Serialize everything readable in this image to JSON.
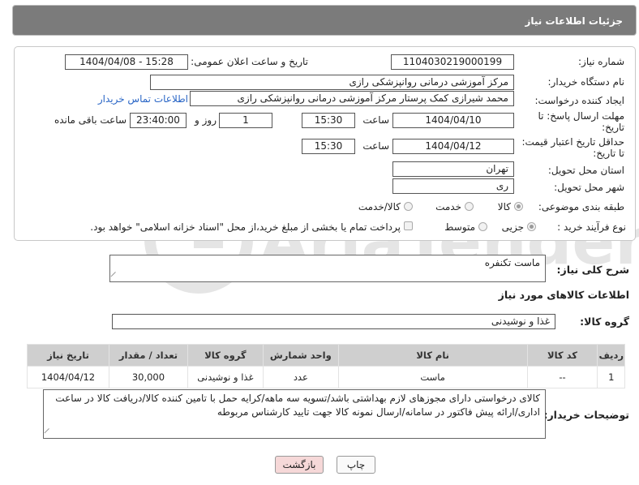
{
  "header": {
    "title": "جزئیات اطلاعات نیاز"
  },
  "labels": {
    "need_number": "شماره نیاز:",
    "announce_datetime": "تاریخ و ساعت اعلان عمومی:",
    "buyer_org": "نام دستگاه خریدار:",
    "requester": "ایجاد کننده درخواست:",
    "contact_link": "اطلاعات تماس خریدار",
    "reply_deadline_1": "مهلت ارسال پاسخ: تا",
    "reply_deadline_2": "تاریخ:",
    "time": "ساعت",
    "day_and": "روز و",
    "remaining": "ساعت باقی مانده",
    "price_validity_1": "حداقل تاریخ اعتبار قیمت:",
    "price_validity_2": "تا تاریخ:",
    "province": "استان محل تحویل:",
    "city": "شهر محل تحویل:",
    "category": "طبقه بندی موضوعی:",
    "process": "نوع فرآیند خرید :",
    "general_desc": "شرح کلی نیاز:",
    "items_info": "اطلاعات کالاهای مورد نیاز",
    "goods_group": "گروه کالا:",
    "buyer_notes": "توضیحات خریدار:"
  },
  "values": {
    "need_number": "1104030219000199",
    "announce_datetime": "1404/04/08 - 15:28",
    "buyer_org": "مرکز آموزشی درمانی روانپزشکی رازی",
    "requester": "محمد شیرازی کمک پرستار مرکز آموزشی درمانی روانپزشکی رازی",
    "reply_date": "1404/04/10",
    "reply_time": "15:30",
    "reply_days": "1",
    "reply_remaining": "23:40:00",
    "price_date": "1404/04/12",
    "price_time": "15:30",
    "province": "تهران",
    "city": "ری",
    "general_desc": "ماست تکنفره",
    "goods_group": "غذا و نوشیدنی",
    "buyer_notes": "کالای درخواستی دارای مجوزهای لازم بهداشتی باشد/تسویه سه ماهه/کرایه حمل با تامین کننده کالا/دریافت کالا در ساعت اداری/ارائه پیش فاکتور در سامانه/ارسال نمونه کالا جهت تایید کارشناس مربوطه"
  },
  "category_options": [
    {
      "label": "کالا",
      "selected": true
    },
    {
      "label": "خدمت",
      "selected": false
    },
    {
      "label": "کالا/خدمت",
      "selected": false
    }
  ],
  "process_options": [
    {
      "label": "جزیی",
      "selected": true
    },
    {
      "label": "متوسط",
      "selected": false
    }
  ],
  "payment_note": "پرداخت تمام یا بخشی از مبلغ خرید،از محل \"اسناد خزانه اسلامی\" خواهد بود.",
  "table": {
    "headers": [
      "ردیف",
      "کد کالا",
      "نام کالا",
      "واحد شمارش",
      "گروه کالا",
      "تعداد / مقدار",
      "تاریخ نیاز"
    ],
    "rows": [
      [
        "1",
        "--",
        "ماست",
        "عدد",
        "غذا و نوشیدنی",
        "30,000",
        "1404/04/12"
      ]
    ]
  },
  "buttons": {
    "print": "چاپ",
    "back": "بازگشت"
  },
  "watermark": "AriaTender.net",
  "colors": {
    "header_bg": "#7b7b7b",
    "link": "#2a66c6",
    "back_button_bg": "#f6d8d8",
    "table_header_bg": "#cfcfcf"
  }
}
